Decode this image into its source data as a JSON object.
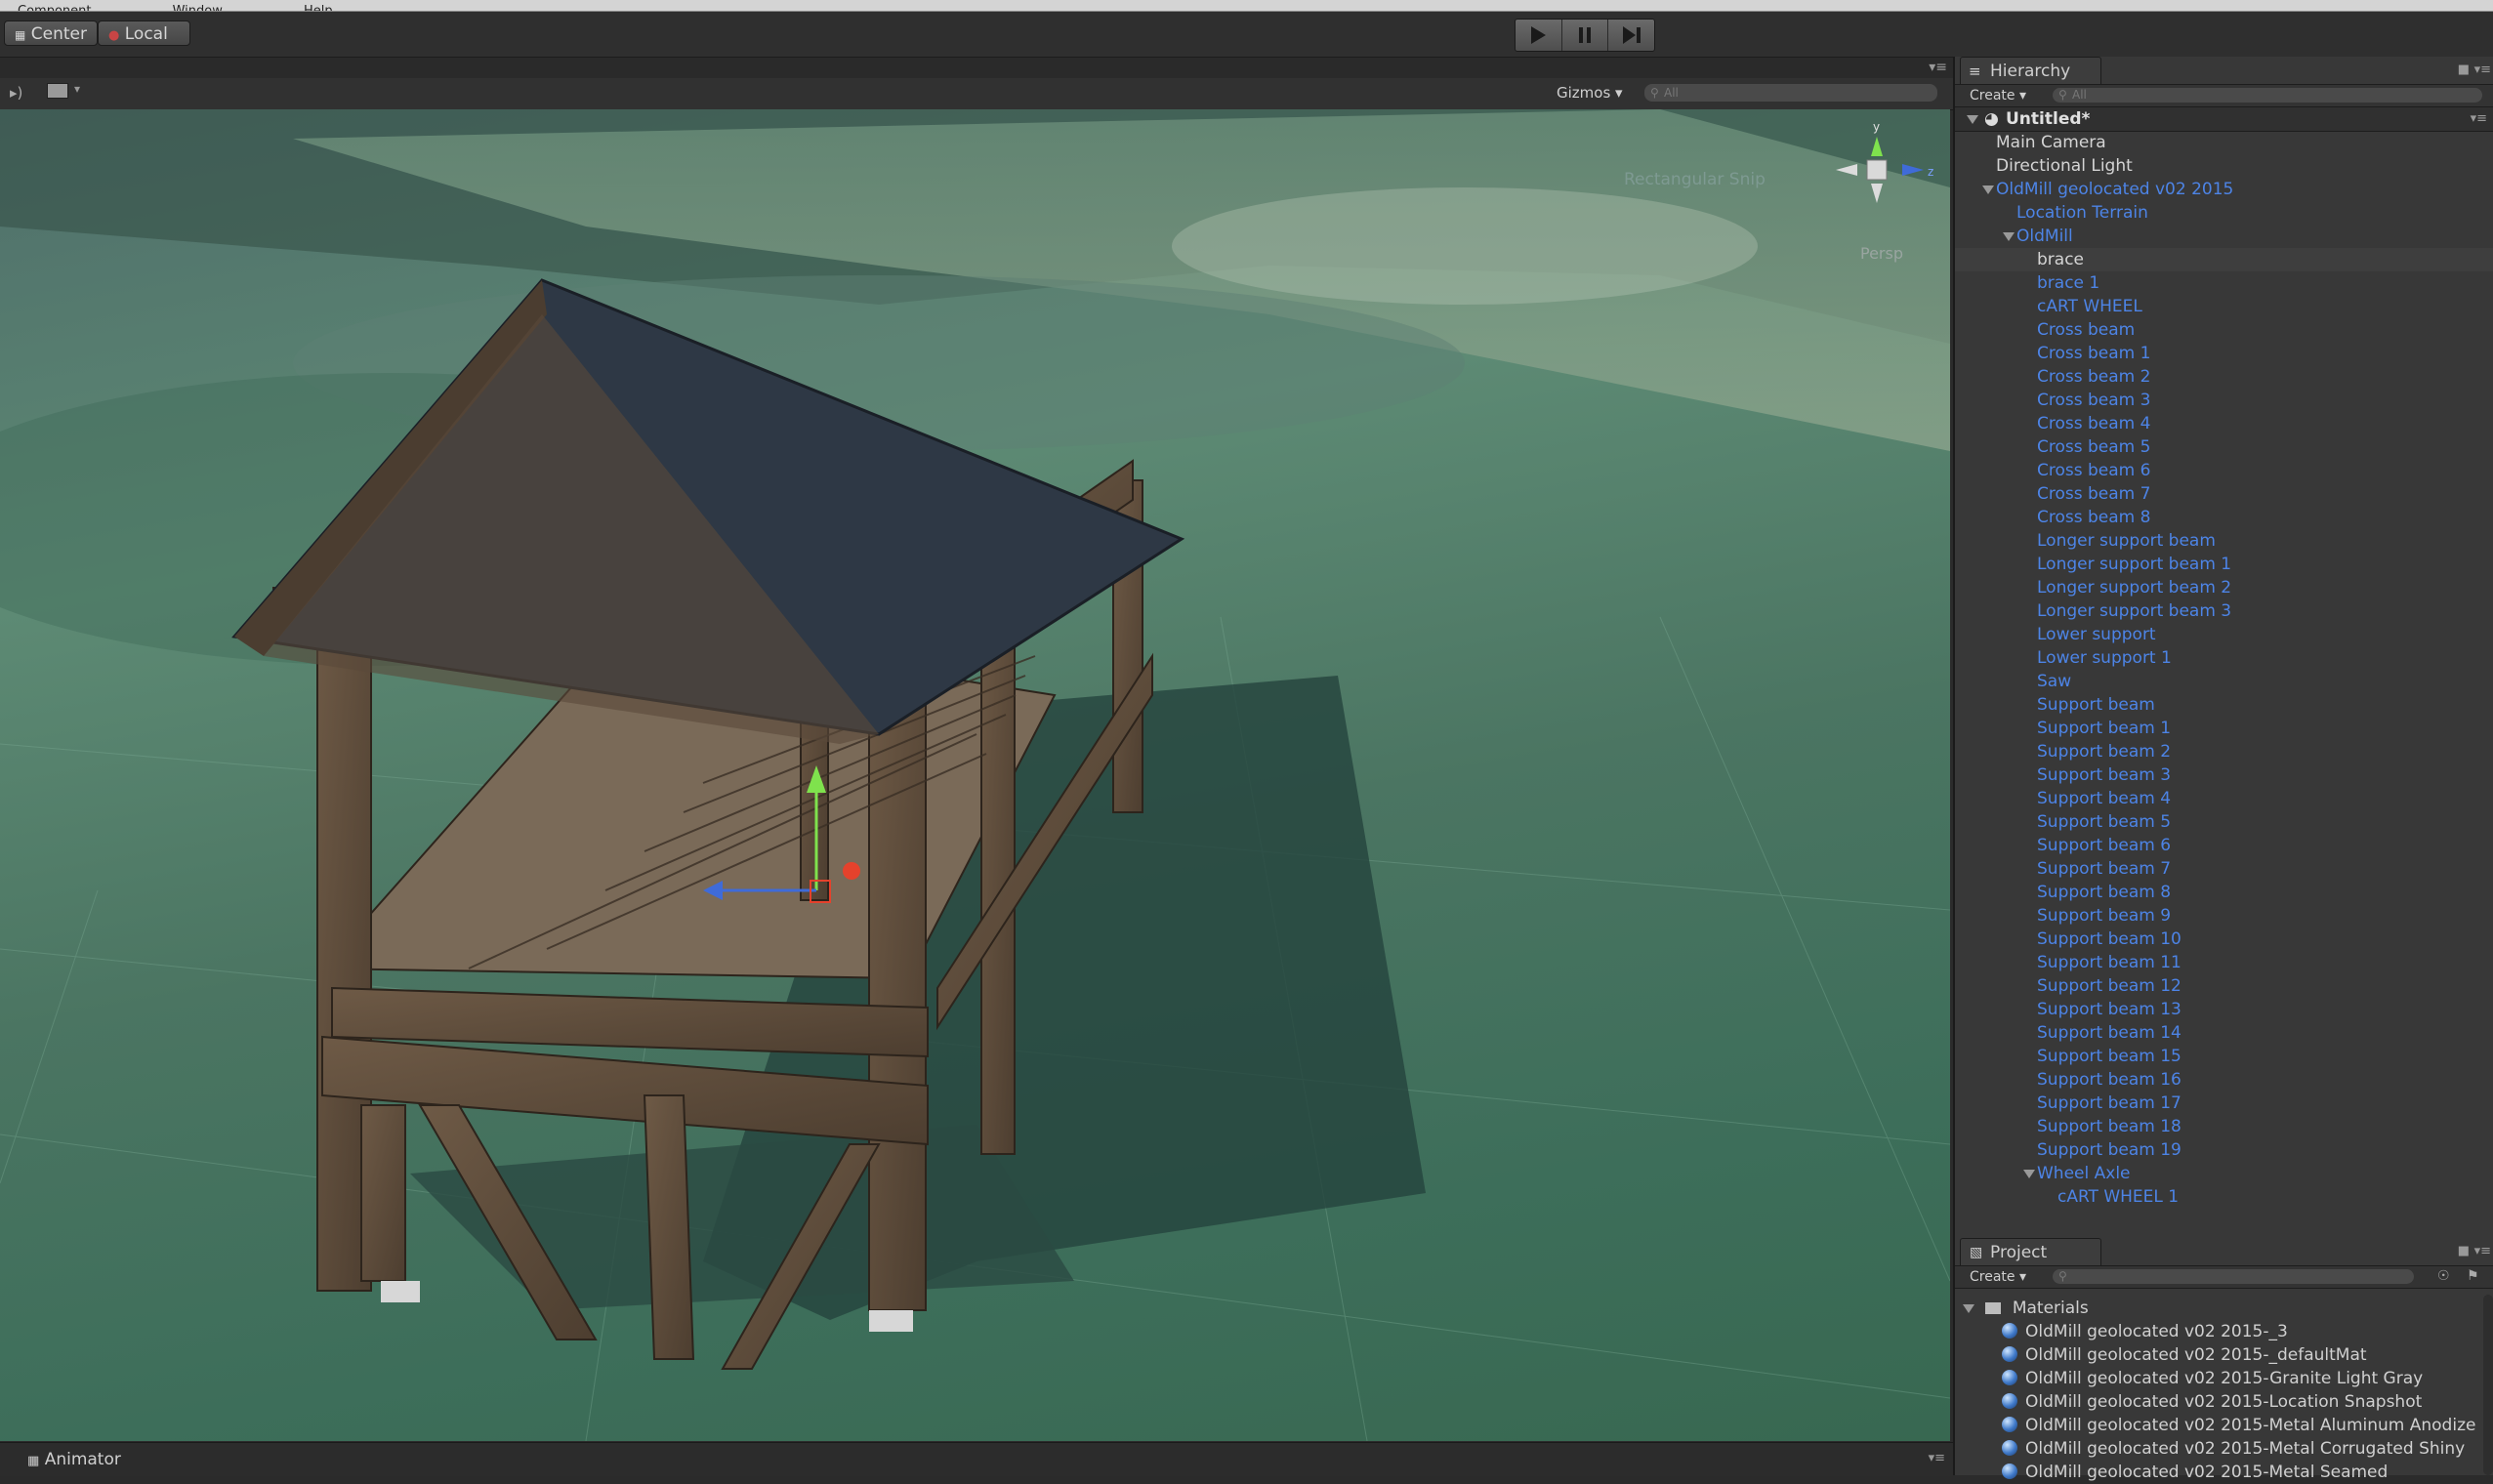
{
  "menu": {
    "items": [
      "Component",
      "Window",
      "Help"
    ]
  },
  "toolbar": {
    "pivot_label": "Center",
    "space_label": "Local",
    "play_icon": "play-icon",
    "pause_icon": "pause-icon",
    "step_icon": "step-icon"
  },
  "scene": {
    "gizmos_label": "Gizmos",
    "search_placeholder": "All",
    "overlay_text": "Rectangular Snip",
    "persp_label": "Persp",
    "axis_labels": {
      "y": "y",
      "z": "z"
    }
  },
  "animator": {
    "tab_label": "Animator"
  },
  "hierarchy": {
    "tab_label": "Hierarchy",
    "create_label": "Create",
    "search_placeholder": "All",
    "scene_name": "Untitled*",
    "items": [
      {
        "label": "Main Camera",
        "indent": 0,
        "color": "white"
      },
      {
        "label": "Directional Light",
        "indent": 0,
        "color": "white"
      },
      {
        "label": "OldMill geolocated v02 2015",
        "indent": 0,
        "color": "blue",
        "expanded": true
      },
      {
        "label": "Location Terrain",
        "indent": 1,
        "color": "blue"
      },
      {
        "label": "OldMill",
        "indent": 1,
        "color": "blue",
        "expanded": true
      },
      {
        "label": "brace",
        "indent": 2,
        "color": "white",
        "selected": true
      },
      {
        "label": "brace 1",
        "indent": 2,
        "color": "blue"
      },
      {
        "label": "cART WHEEL",
        "indent": 2,
        "color": "blue"
      },
      {
        "label": "Cross beam",
        "indent": 2,
        "color": "blue"
      },
      {
        "label": "Cross beam 1",
        "indent": 2,
        "color": "blue"
      },
      {
        "label": "Cross beam 2",
        "indent": 2,
        "color": "blue"
      },
      {
        "label": "Cross beam 3",
        "indent": 2,
        "color": "blue"
      },
      {
        "label": "Cross beam 4",
        "indent": 2,
        "color": "blue"
      },
      {
        "label": "Cross beam 5",
        "indent": 2,
        "color": "blue"
      },
      {
        "label": "Cross beam 6",
        "indent": 2,
        "color": "blue"
      },
      {
        "label": "Cross beam 7",
        "indent": 2,
        "color": "blue"
      },
      {
        "label": "Cross beam 8",
        "indent": 2,
        "color": "blue"
      },
      {
        "label": "Longer support beam",
        "indent": 2,
        "color": "blue"
      },
      {
        "label": "Longer support beam 1",
        "indent": 2,
        "color": "blue"
      },
      {
        "label": "Longer support beam 2",
        "indent": 2,
        "color": "blue"
      },
      {
        "label": "Longer support beam 3",
        "indent": 2,
        "color": "blue"
      },
      {
        "label": "Lower support",
        "indent": 2,
        "color": "blue"
      },
      {
        "label": "Lower support 1",
        "indent": 2,
        "color": "blue"
      },
      {
        "label": "Saw",
        "indent": 2,
        "color": "blue"
      },
      {
        "label": "Support beam",
        "indent": 2,
        "color": "blue"
      },
      {
        "label": "Support beam 1",
        "indent": 2,
        "color": "blue"
      },
      {
        "label": "Support beam 2",
        "indent": 2,
        "color": "blue"
      },
      {
        "label": "Support beam 3",
        "indent": 2,
        "color": "blue"
      },
      {
        "label": "Support beam 4",
        "indent": 2,
        "color": "blue"
      },
      {
        "label": "Support beam 5",
        "indent": 2,
        "color": "blue"
      },
      {
        "label": "Support beam 6",
        "indent": 2,
        "color": "blue"
      },
      {
        "label": "Support beam 7",
        "indent": 2,
        "color": "blue"
      },
      {
        "label": "Support beam 8",
        "indent": 2,
        "color": "blue"
      },
      {
        "label": "Support beam 9",
        "indent": 2,
        "color": "blue"
      },
      {
        "label": "Support beam 10",
        "indent": 2,
        "color": "blue"
      },
      {
        "label": "Support beam 11",
        "indent": 2,
        "color": "blue"
      },
      {
        "label": "Support beam 12",
        "indent": 2,
        "color": "blue"
      },
      {
        "label": "Support beam 13",
        "indent": 2,
        "color": "blue"
      },
      {
        "label": "Support beam 14",
        "indent": 2,
        "color": "blue"
      },
      {
        "label": "Support beam 15",
        "indent": 2,
        "color": "blue"
      },
      {
        "label": "Support beam 16",
        "indent": 2,
        "color": "blue"
      },
      {
        "label": "Support beam 17",
        "indent": 2,
        "color": "blue"
      },
      {
        "label": "Support beam 18",
        "indent": 2,
        "color": "blue"
      },
      {
        "label": "Support beam 19",
        "indent": 2,
        "color": "blue"
      },
      {
        "label": "Wheel Axle",
        "indent": 2,
        "color": "blue",
        "expanded": true
      },
      {
        "label": "cART WHEEL 1",
        "indent": 3,
        "color": "blue"
      }
    ]
  },
  "project": {
    "tab_label": "Project",
    "create_label": "Create",
    "folder_label": "Materials",
    "materials": [
      "OldMill geolocated v02 2015-_3",
      "OldMill geolocated v02 2015-_defaultMat",
      "OldMill geolocated v02 2015-Granite Light Gray",
      "OldMill geolocated v02 2015-Location Snapshot",
      "OldMill geolocated v02 2015-Metal Aluminum Anodize",
      "OldMill geolocated v02 2015-Metal Corrugated Shiny",
      "OldMill geolocated v02 2015-Metal Seamed"
    ]
  },
  "colors": {
    "link_blue": "#4d84e6",
    "panel_bg": "#383838",
    "selected_row": "#3e3e3e"
  }
}
